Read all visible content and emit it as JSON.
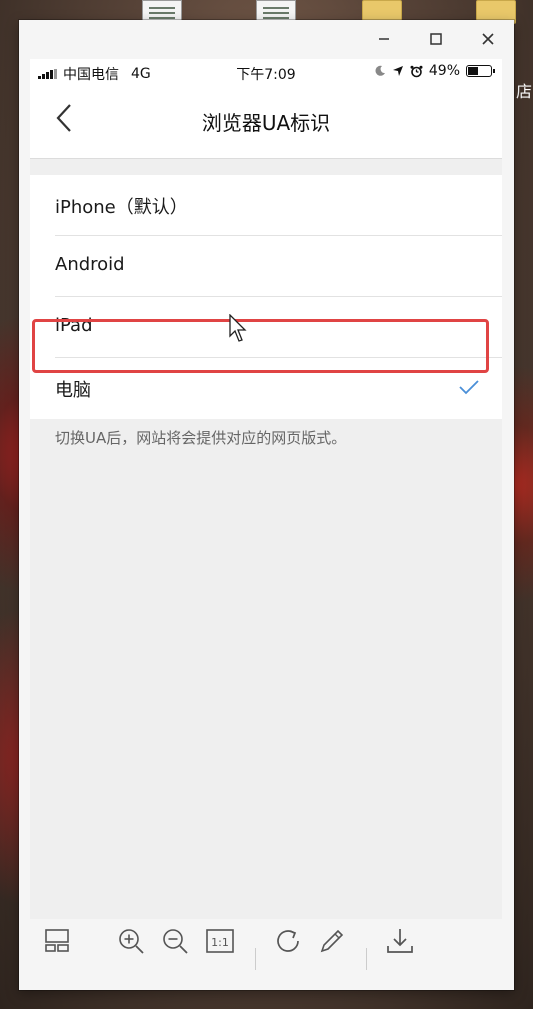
{
  "desktop": {
    "partial_label": "店"
  },
  "window": {
    "controls": {
      "minimize": "minimize",
      "maximize": "maximize",
      "close": "close"
    }
  },
  "statusbar": {
    "carrier": "中国电信",
    "network": "4G",
    "time": "下午7:09",
    "battery_text": "49%",
    "battery_level": 0.49
  },
  "navbar": {
    "title": "浏览器UA标识"
  },
  "options": [
    {
      "label": "iPhone（默认）",
      "selected": false
    },
    {
      "label": "Android",
      "selected": false
    },
    {
      "label": "iPad",
      "selected": false
    },
    {
      "label": "电脑",
      "selected": true
    }
  ],
  "hint": "切换UA后，网站将会提供对应的网页版式。",
  "colors": {
    "accent_check": "#4a8fd8",
    "highlight_border": "#e04444"
  },
  "toolbar": {
    "icons": [
      "layout-icon",
      "zoom-in-icon",
      "zoom-out-icon",
      "actual-size-icon",
      "rotate-icon",
      "edit-icon",
      "download-icon"
    ],
    "actual_size_text": "1:1"
  }
}
